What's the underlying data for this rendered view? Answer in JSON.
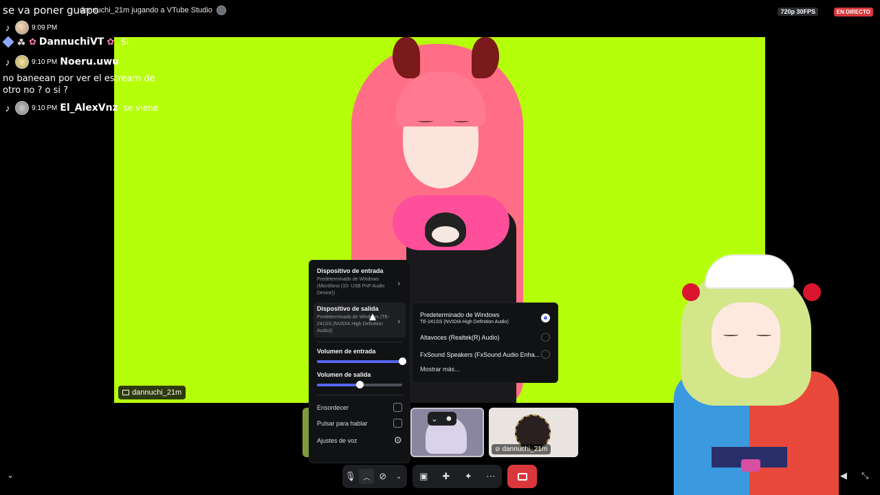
{
  "overlay": {
    "title": "se va poner guapo",
    "activity": "dannuchi_21m jugando a VTube Studio",
    "quality": "720p 30FPS",
    "live": "EN DIRECTO"
  },
  "chat": {
    "line1": {
      "time": "9:09 PM"
    },
    "line2": {
      "user": "DannuchiVT",
      "message": "Si"
    },
    "line3": {
      "time": "9:10 PM",
      "user": "Noeru.uwu",
      "message": "no baneean por ver el estream de otro no ? o si ?"
    },
    "line4": {
      "time": "9:10 PM",
      "user": "El_AlexVnz",
      "message": "se viene"
    }
  },
  "stream": {
    "label": "dannuchi_21m"
  },
  "tiles": {
    "tile2_label": "dannuchi_21m"
  },
  "menu": {
    "input": {
      "title": "Dispositivo de entrada",
      "sub": "Predeterminado de Windows (Micrófono (10- USB PnP Audio Device))"
    },
    "output": {
      "title": "Dispositivo de salida",
      "sub": "Predeterminado de Windows (TE-241SS (NVIDIA High Definition Audio))"
    },
    "input_volume": {
      "label": "Volumen de entrada",
      "value": 100
    },
    "output_volume": {
      "label": "Volumen de salida",
      "value": 50
    },
    "deafen": "Ensordecer",
    "push_to_talk": "Pulsar para hablar",
    "voice_settings": "Ajustes de voz"
  },
  "submenu": {
    "options": [
      {
        "title": "Predeterminado de Windows",
        "sub": "TE-241SS (NVIDIA High Definition Audio)",
        "selected": true
      },
      {
        "title": "Altavoces (Realtek(R) Audio)",
        "selected": false
      },
      {
        "title": "FxSound Speakers (FxSound Audio Enha...",
        "selected": false
      }
    ],
    "more": "Mostrar más..."
  },
  "icons": [
    "tiktok-icon",
    "mic-icon",
    "camera-off-icon",
    "screen-share-icon",
    "activities-icon",
    "soundboard-icon",
    "more-icon",
    "end-call-icon",
    "volume-icon",
    "fullscreen-exit-icon",
    "gear-icon",
    "chevron-right-icon"
  ],
  "colors": {
    "stream_bg": "#b6ff0a",
    "accent": "#5865f2",
    "danger": "#da373c"
  }
}
